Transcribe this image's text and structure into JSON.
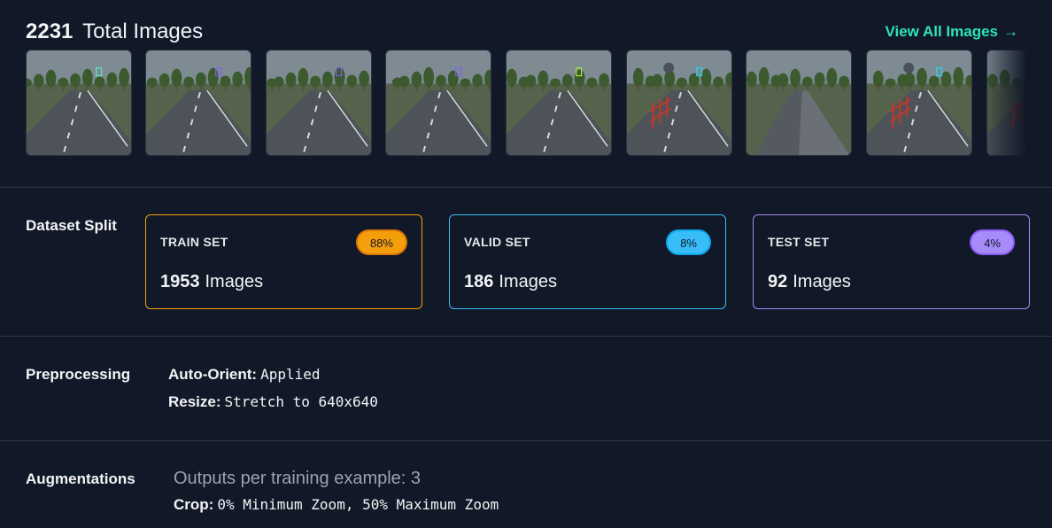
{
  "header": {
    "total_count": "2231",
    "total_label": "Total Images",
    "view_all_label": "View All Images",
    "view_all_icon": "arrow-right-icon"
  },
  "thumbnails": [
    {
      "variant": "road-boxes",
      "box_color": "#63e6be"
    },
    {
      "variant": "road-boxes",
      "box_color": "#8b5cf6"
    },
    {
      "variant": "road-boxes",
      "box_color": "#8b5cf6"
    },
    {
      "variant": "road-boxes",
      "box_color": "#8b5cf6"
    },
    {
      "variant": "road-boxes",
      "box_color": "#a3e635"
    },
    {
      "variant": "barrier",
      "box_color": "#22d3ee"
    },
    {
      "variant": "wide-road",
      "box_color": ""
    },
    {
      "variant": "barrier",
      "box_color": "#22d3ee"
    },
    {
      "variant": "barrier",
      "box_color": ""
    }
  ],
  "dataset_split": {
    "label": "Dataset Split",
    "sets": [
      {
        "name": "TRAIN SET",
        "percent": "88%",
        "count": "1953",
        "unit": "Images",
        "color": "#f59e0b",
        "badge_border": "#d97706"
      },
      {
        "name": "VALID SET",
        "percent": "8%",
        "count": "186",
        "unit": "Images",
        "color": "#38bdf8",
        "badge_border": "#0ea5e9"
      },
      {
        "name": "TEST SET",
        "percent": "4%",
        "count": "92",
        "unit": "Images",
        "color": "#a78bfa",
        "badge_border": "#8b5cf6"
      }
    ]
  },
  "preprocessing": {
    "label": "Preprocessing",
    "items": [
      {
        "key": "Auto-Orient:",
        "value": "Applied"
      },
      {
        "key": "Resize:",
        "value": "Stretch to 640x640"
      }
    ]
  },
  "augmentations": {
    "label": "Augmentations",
    "outputs": "Outputs per training example: 3",
    "items": [
      {
        "key": "Crop:",
        "value": "0% Minimum Zoom, 50% Maximum Zoom"
      }
    ]
  }
}
